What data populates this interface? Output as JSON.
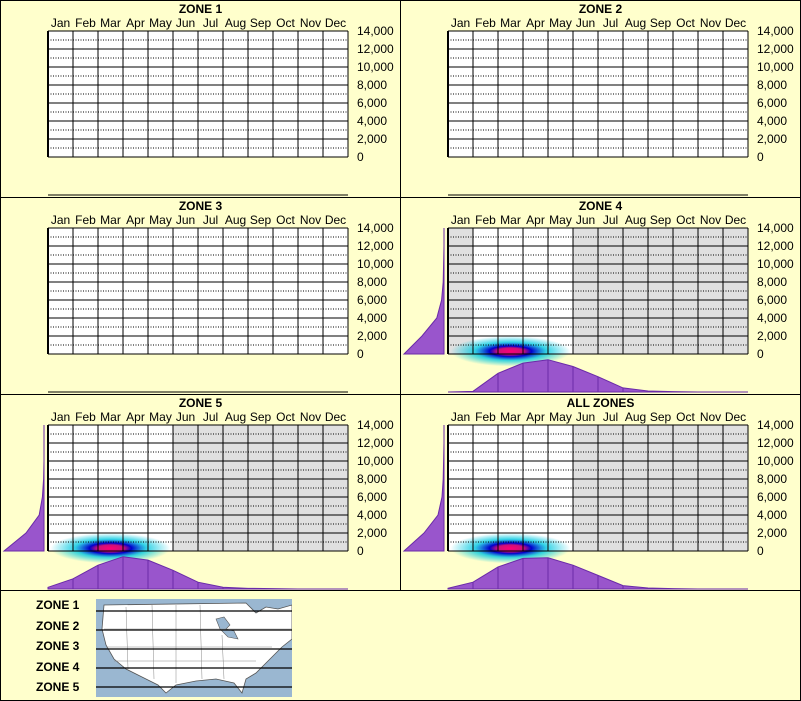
{
  "months": [
    "Jan",
    "Feb",
    "Mar",
    "Apr",
    "May",
    "Jun",
    "Jul",
    "Aug",
    "Sep",
    "Oct",
    "Nov",
    "Dec"
  ],
  "y_ticks": [
    "14,000",
    "12,000",
    "10,000",
    "8,000",
    "6,000",
    "4,000",
    "2,000",
    "0"
  ],
  "panels": [
    {
      "title": "ZONE 1",
      "has_data": false,
      "active_months": []
    },
    {
      "title": "ZONE 2",
      "has_data": false,
      "active_months": []
    },
    {
      "title": "ZONE 3",
      "has_data": false,
      "active_months": []
    },
    {
      "title": "ZONE 4",
      "has_data": true,
      "active_months": [
        1,
        2,
        3,
        4
      ]
    },
    {
      "title": "ZONE 5",
      "has_data": true,
      "active_months": [
        0,
        1,
        2,
        3,
        4
      ]
    },
    {
      "title": "ALL ZONES",
      "has_data": true,
      "active_months": [
        0,
        1,
        2,
        3,
        4
      ]
    }
  ],
  "legend": {
    "zones": [
      "ZONE 1",
      "ZONE 2",
      "ZONE 3",
      "ZONE 4",
      "ZONE 5"
    ]
  },
  "colors": {
    "background": "#ffffcc",
    "inactive_month": "#e0e0e0",
    "density_fill": "#9955cc",
    "density_stroke": "#6a2aa8",
    "hotspot_core": "#ff0077",
    "hotspot_glow": "#00c8e0",
    "map_water": "#9ab7d1",
    "map_land": "#ffffff"
  },
  "chart_data": [
    {
      "type": "heatmap",
      "title": "ZONE 1",
      "x": [
        "Jan",
        "Feb",
        "Mar",
        "Apr",
        "May",
        "Jun",
        "Jul",
        "Aug",
        "Sep",
        "Oct",
        "Nov",
        "Dec"
      ],
      "ylim": [
        0,
        14000
      ],
      "y_ticks": [
        0,
        2000,
        4000,
        6000,
        8000,
        10000,
        12000,
        14000
      ],
      "data": []
    },
    {
      "type": "heatmap",
      "title": "ZONE 2",
      "x": [
        "Jan",
        "Feb",
        "Mar",
        "Apr",
        "May",
        "Jun",
        "Jul",
        "Aug",
        "Sep",
        "Oct",
        "Nov",
        "Dec"
      ],
      "ylim": [
        0,
        14000
      ],
      "y_ticks": [
        0,
        2000,
        4000,
        6000,
        8000,
        10000,
        12000,
        14000
      ],
      "data": []
    },
    {
      "type": "heatmap",
      "title": "ZONE 3",
      "x": [
        "Jan",
        "Feb",
        "Mar",
        "Apr",
        "May",
        "Jun",
        "Jul",
        "Aug",
        "Sep",
        "Oct",
        "Nov",
        "Dec"
      ],
      "ylim": [
        0,
        14000
      ],
      "y_ticks": [
        0,
        2000,
        4000,
        6000,
        8000,
        10000,
        12000,
        14000
      ],
      "data": []
    },
    {
      "type": "heatmap",
      "title": "ZONE 4",
      "x": [
        "Jan",
        "Feb",
        "Mar",
        "Apr",
        "May",
        "Jun",
        "Jul",
        "Aug",
        "Sep",
        "Oct",
        "Nov",
        "Dec"
      ],
      "ylim": [
        0,
        14000
      ],
      "y_ticks": [
        0,
        2000,
        4000,
        6000,
        8000,
        10000,
        12000,
        14000
      ],
      "hotspot": {
        "month_center": 2.5,
        "elevation_center": 300,
        "month_spread": 1.0,
        "elevation_spread": 600
      },
      "monthly_density": [
        0,
        0.02,
        0.55,
        0.85,
        0.95,
        0.75,
        0.45,
        0.12,
        0.03,
        0.01,
        0,
        0,
        0
      ],
      "elevation_density": [
        1.0,
        0.55,
        0.18,
        0.06,
        0.02,
        0.01,
        0,
        0
      ]
    },
    {
      "type": "heatmap",
      "title": "ZONE 5",
      "x": [
        "Jan",
        "Feb",
        "Mar",
        "Apr",
        "May",
        "Jun",
        "Jul",
        "Aug",
        "Sep",
        "Oct",
        "Nov",
        "Dec"
      ],
      "ylim": [
        0,
        14000
      ],
      "y_ticks": [
        0,
        2000,
        4000,
        6000,
        8000,
        10000,
        12000,
        14000
      ],
      "hotspot": {
        "month_center": 2.5,
        "elevation_center": 300,
        "month_spread": 1.0,
        "elevation_spread": 600
      },
      "monthly_density": [
        0.05,
        0.3,
        0.7,
        0.95,
        0.85,
        0.55,
        0.2,
        0.05,
        0.02,
        0.01,
        0,
        0,
        0
      ],
      "elevation_density": [
        1.0,
        0.45,
        0.12,
        0.04,
        0.01,
        0,
        0,
        0
      ]
    },
    {
      "type": "heatmap",
      "title": "ALL ZONES",
      "x": [
        "Jan",
        "Feb",
        "Mar",
        "Apr",
        "May",
        "Jun",
        "Jul",
        "Aug",
        "Sep",
        "Oct",
        "Nov",
        "Dec"
      ],
      "ylim": [
        0,
        14000
      ],
      "y_ticks": [
        0,
        2000,
        4000,
        6000,
        8000,
        10000,
        12000,
        14000
      ],
      "hotspot": {
        "month_center": 2.5,
        "elevation_center": 300,
        "month_spread": 1.0,
        "elevation_spread": 600
      },
      "monthly_density": [
        0.02,
        0.2,
        0.65,
        0.9,
        0.92,
        0.7,
        0.4,
        0.1,
        0.03,
        0.01,
        0,
        0,
        0
      ],
      "elevation_density": [
        1.0,
        0.5,
        0.15,
        0.05,
        0.02,
        0.01,
        0,
        0
      ]
    }
  ]
}
